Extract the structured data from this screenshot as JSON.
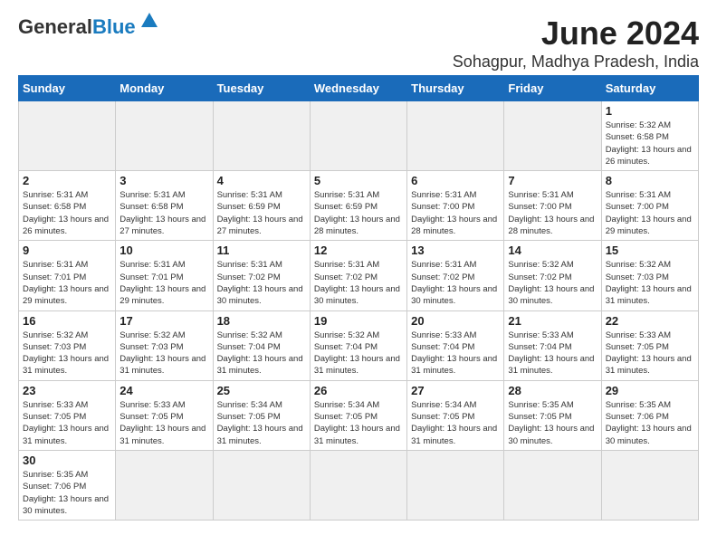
{
  "header": {
    "logo_general": "General",
    "logo_blue": "Blue",
    "month_title": "June 2024",
    "location": "Sohagpur, Madhya Pradesh, India"
  },
  "weekdays": [
    "Sunday",
    "Monday",
    "Tuesday",
    "Wednesday",
    "Thursday",
    "Friday",
    "Saturday"
  ],
  "weeks": [
    [
      {
        "day": "",
        "info": ""
      },
      {
        "day": "",
        "info": ""
      },
      {
        "day": "",
        "info": ""
      },
      {
        "day": "",
        "info": ""
      },
      {
        "day": "",
        "info": ""
      },
      {
        "day": "",
        "info": ""
      },
      {
        "day": "1",
        "info": "Sunrise: 5:32 AM\nSunset: 6:58 PM\nDaylight: 13 hours and 26 minutes."
      }
    ],
    [
      {
        "day": "2",
        "info": "Sunrise: 5:31 AM\nSunset: 6:58 PM\nDaylight: 13 hours and 26 minutes."
      },
      {
        "day": "3",
        "info": "Sunrise: 5:31 AM\nSunset: 6:58 PM\nDaylight: 13 hours and 27 minutes."
      },
      {
        "day": "4",
        "info": "Sunrise: 5:31 AM\nSunset: 6:59 PM\nDaylight: 13 hours and 27 minutes."
      },
      {
        "day": "5",
        "info": "Sunrise: 5:31 AM\nSunset: 6:59 PM\nDaylight: 13 hours and 28 minutes."
      },
      {
        "day": "6",
        "info": "Sunrise: 5:31 AM\nSunset: 7:00 PM\nDaylight: 13 hours and 28 minutes."
      },
      {
        "day": "7",
        "info": "Sunrise: 5:31 AM\nSunset: 7:00 PM\nDaylight: 13 hours and 28 minutes."
      },
      {
        "day": "8",
        "info": "Sunrise: 5:31 AM\nSunset: 7:00 PM\nDaylight: 13 hours and 29 minutes."
      }
    ],
    [
      {
        "day": "9",
        "info": "Sunrise: 5:31 AM\nSunset: 7:01 PM\nDaylight: 13 hours and 29 minutes."
      },
      {
        "day": "10",
        "info": "Sunrise: 5:31 AM\nSunset: 7:01 PM\nDaylight: 13 hours and 29 minutes."
      },
      {
        "day": "11",
        "info": "Sunrise: 5:31 AM\nSunset: 7:02 PM\nDaylight: 13 hours and 30 minutes."
      },
      {
        "day": "12",
        "info": "Sunrise: 5:31 AM\nSunset: 7:02 PM\nDaylight: 13 hours and 30 minutes."
      },
      {
        "day": "13",
        "info": "Sunrise: 5:31 AM\nSunset: 7:02 PM\nDaylight: 13 hours and 30 minutes."
      },
      {
        "day": "14",
        "info": "Sunrise: 5:32 AM\nSunset: 7:02 PM\nDaylight: 13 hours and 30 minutes."
      },
      {
        "day": "15",
        "info": "Sunrise: 5:32 AM\nSunset: 7:03 PM\nDaylight: 13 hours and 31 minutes."
      }
    ],
    [
      {
        "day": "16",
        "info": "Sunrise: 5:32 AM\nSunset: 7:03 PM\nDaylight: 13 hours and 31 minutes."
      },
      {
        "day": "17",
        "info": "Sunrise: 5:32 AM\nSunset: 7:03 PM\nDaylight: 13 hours and 31 minutes."
      },
      {
        "day": "18",
        "info": "Sunrise: 5:32 AM\nSunset: 7:04 PM\nDaylight: 13 hours and 31 minutes."
      },
      {
        "day": "19",
        "info": "Sunrise: 5:32 AM\nSunset: 7:04 PM\nDaylight: 13 hours and 31 minutes."
      },
      {
        "day": "20",
        "info": "Sunrise: 5:33 AM\nSunset: 7:04 PM\nDaylight: 13 hours and 31 minutes."
      },
      {
        "day": "21",
        "info": "Sunrise: 5:33 AM\nSunset: 7:04 PM\nDaylight: 13 hours and 31 minutes."
      },
      {
        "day": "22",
        "info": "Sunrise: 5:33 AM\nSunset: 7:05 PM\nDaylight: 13 hours and 31 minutes."
      }
    ],
    [
      {
        "day": "23",
        "info": "Sunrise: 5:33 AM\nSunset: 7:05 PM\nDaylight: 13 hours and 31 minutes."
      },
      {
        "day": "24",
        "info": "Sunrise: 5:33 AM\nSunset: 7:05 PM\nDaylight: 13 hours and 31 minutes."
      },
      {
        "day": "25",
        "info": "Sunrise: 5:34 AM\nSunset: 7:05 PM\nDaylight: 13 hours and 31 minutes."
      },
      {
        "day": "26",
        "info": "Sunrise: 5:34 AM\nSunset: 7:05 PM\nDaylight: 13 hours and 31 minutes."
      },
      {
        "day": "27",
        "info": "Sunrise: 5:34 AM\nSunset: 7:05 PM\nDaylight: 13 hours and 31 minutes."
      },
      {
        "day": "28",
        "info": "Sunrise: 5:35 AM\nSunset: 7:05 PM\nDaylight: 13 hours and 30 minutes."
      },
      {
        "day": "29",
        "info": "Sunrise: 5:35 AM\nSunset: 7:06 PM\nDaylight: 13 hours and 30 minutes."
      }
    ],
    [
      {
        "day": "30",
        "info": "Sunrise: 5:35 AM\nSunset: 7:06 PM\nDaylight: 13 hours and 30 minutes."
      },
      {
        "day": "",
        "info": ""
      },
      {
        "day": "",
        "info": ""
      },
      {
        "day": "",
        "info": ""
      },
      {
        "day": "",
        "info": ""
      },
      {
        "day": "",
        "info": ""
      },
      {
        "day": "",
        "info": ""
      }
    ]
  ]
}
